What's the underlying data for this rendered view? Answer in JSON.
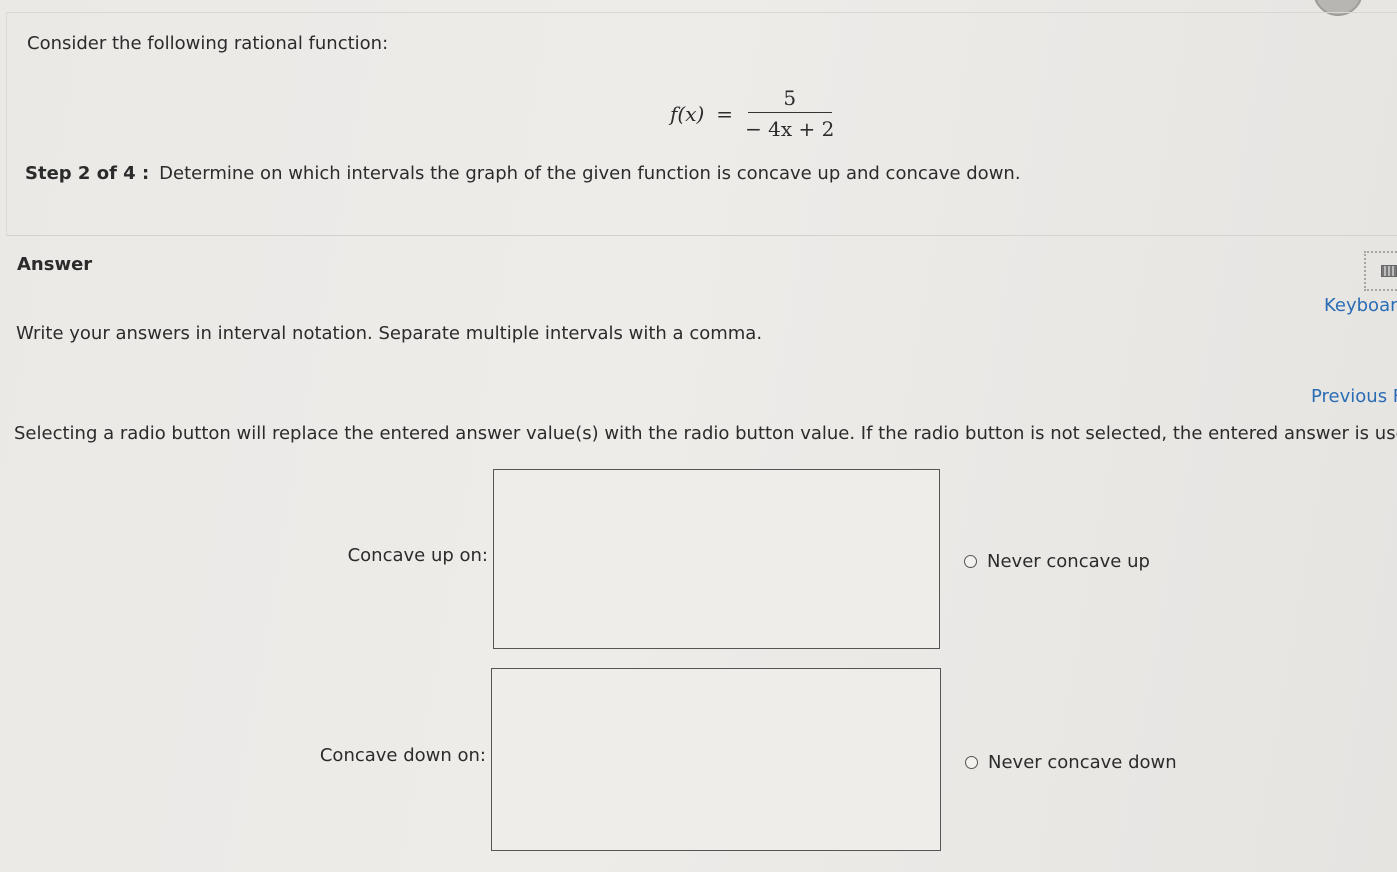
{
  "question": {
    "intro": "Consider the following rational function:",
    "formula": {
      "lhs": "f(x)",
      "equals": "=",
      "numerator": "5",
      "denominator": "− 4x + 2"
    },
    "step_label": "Step 2 of 4 :",
    "step_text": "Determine on which intervals the graph of the given function is concave up and concave down."
  },
  "answer": {
    "heading": "Answer",
    "keyboard_link": "Keyboar",
    "keyboard_icon": "keyboard-icon",
    "instructions": "Write your answers in interval notation. Separate multiple intervals with a comma.",
    "previous_link": "Previous F",
    "radio_note": "Selecting a radio button will replace the entered answer value(s) with the radio button value. If the radio button is not selected, the entered answer is used.",
    "rows": [
      {
        "label": "Concave up on:",
        "value": "",
        "radio_label": "Never concave up"
      },
      {
        "label": "Concave down on:",
        "value": "",
        "radio_label": "Never concave down"
      }
    ]
  }
}
